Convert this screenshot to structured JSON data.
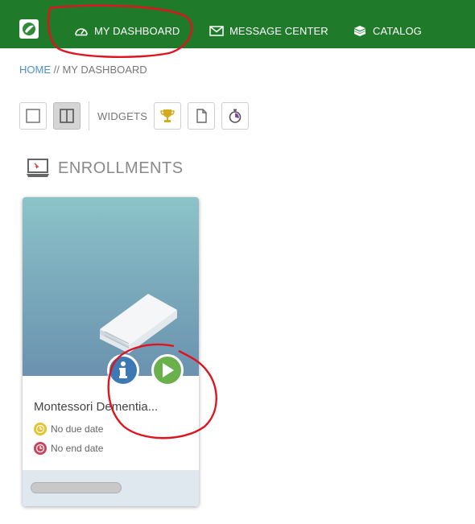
{
  "nav": {
    "items": [
      {
        "label": "MY DASHBOARD",
        "icon": "gauge-icon"
      },
      {
        "label": "MESSAGE CENTER",
        "icon": "envelope-icon"
      },
      {
        "label": "CATALOG",
        "icon": "book-stack-icon"
      }
    ],
    "color": "#1f7a2a"
  },
  "breadcrumb": {
    "home": "HOME",
    "separator": " // ",
    "current": "MY DASHBOARD"
  },
  "toolbar": {
    "widgets_label": "WIDGETS",
    "layout_icons": [
      "single-column-icon",
      "two-column-icon"
    ],
    "widget_icons": [
      "trophy-icon",
      "document-icon",
      "stopwatch-icon"
    ]
  },
  "section": {
    "title": "ENROLLMENTS",
    "icon": "laptop-icon"
  },
  "enrollments": [
    {
      "title": "Montessori Dementia...",
      "due": "No due date",
      "end": "No end date",
      "progress": 0
    }
  ],
  "colors": {
    "info": "#3d7ab3",
    "play": "#6ab04c",
    "due": "#e7c12e",
    "end": "#c8445a",
    "annotation": "#e0141e"
  }
}
